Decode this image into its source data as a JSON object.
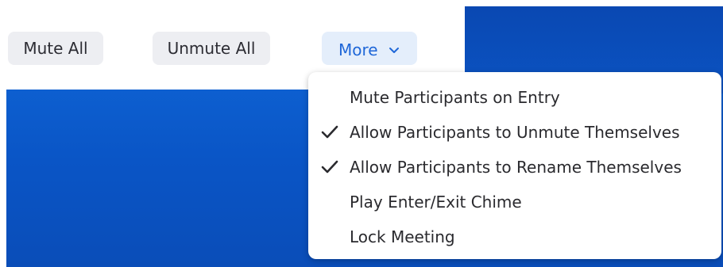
{
  "toolbar": {
    "mute_all_label": "Mute All",
    "unmute_all_label": "Unmute All",
    "more_label": "More",
    "more_icon": "chevron-down-icon"
  },
  "menu": {
    "items": [
      {
        "label": "Mute Participants on Entry",
        "checked": false
      },
      {
        "label": "Allow Participants to Unmute Themselves",
        "checked": true
      },
      {
        "label": "Allow Participants to Rename Themselves",
        "checked": true
      },
      {
        "label": "Play Enter/Exit Chime",
        "checked": false
      },
      {
        "label": "Lock Meeting",
        "checked": false
      }
    ],
    "check_icon": "check-icon"
  },
  "colors": {
    "accent": "#1f67d8",
    "background_blue": "#0b55c6",
    "button_bg": "#edeef2",
    "more_button_bg": "#e4eefb"
  }
}
